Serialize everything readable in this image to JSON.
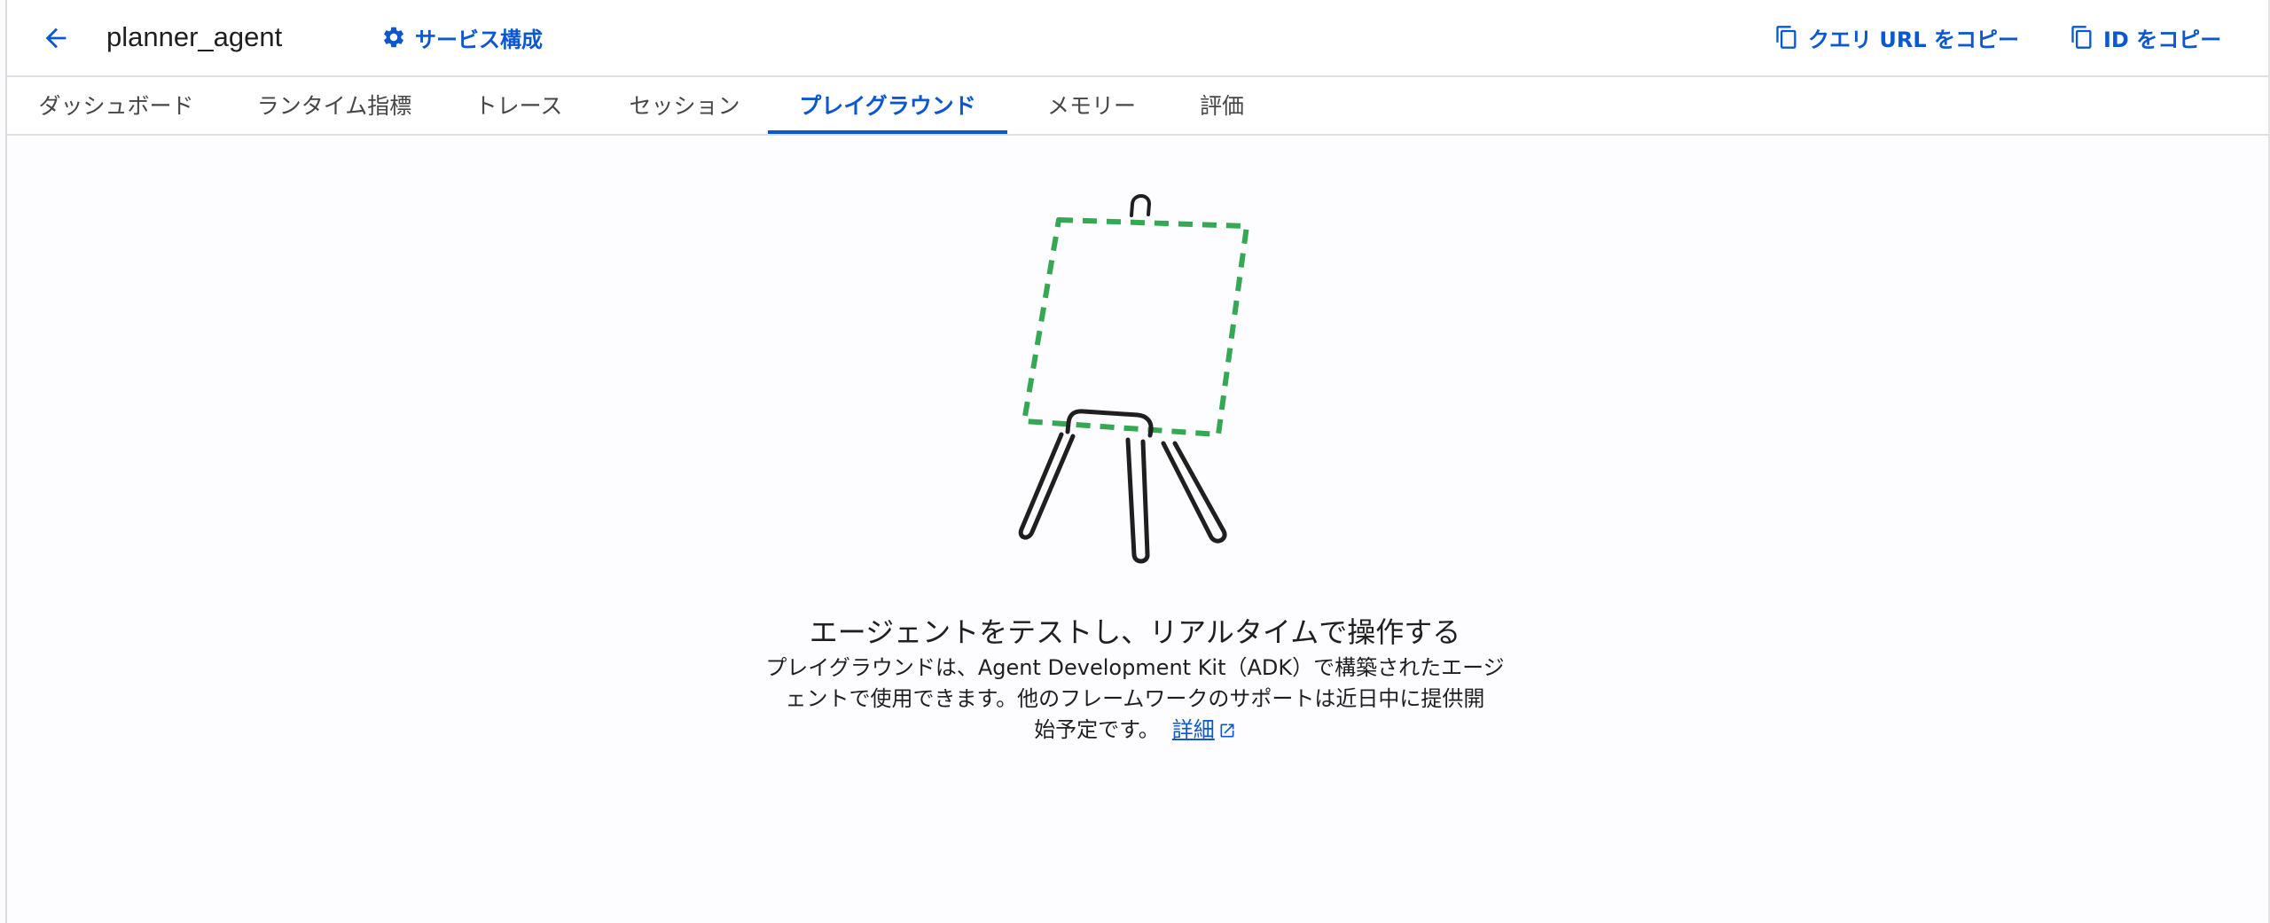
{
  "header": {
    "back_icon": "arrow-back-icon",
    "title": "planner_agent",
    "service_config": {
      "label": "サービス構成",
      "icon": "gear-icon"
    },
    "copy_query_url": {
      "label": "クエリ URL をコピー",
      "icon": "copy-icon"
    },
    "copy_id": {
      "label": "ID をコピー",
      "icon": "copy-icon"
    }
  },
  "tabs": [
    {
      "label": "ダッシュボード"
    },
    {
      "label": "ランタイム指標"
    },
    {
      "label": "トレース"
    },
    {
      "label": "セッション"
    },
    {
      "label": "プレイグラウンド",
      "active": true
    },
    {
      "label": "メモリー"
    },
    {
      "label": "評価"
    }
  ],
  "empty_state": {
    "illustration": "easel-icon",
    "title": "エージェントをテストし、リアルタイムで操作する",
    "body_line1": "プレイグラウンドは、Agent Development Kit（ADK）で構築されたエージ",
    "body_line2": "ェントで使用できます。他のフレームワークのサポートは近日中に提供開",
    "body_line3": "始予定です。",
    "learn_more": "詳細",
    "learn_more_icon": "open-in-new-icon"
  },
  "colors": {
    "accent": "#0b57d0",
    "illustration_green": "#34a853",
    "background": "#fdfcff"
  }
}
